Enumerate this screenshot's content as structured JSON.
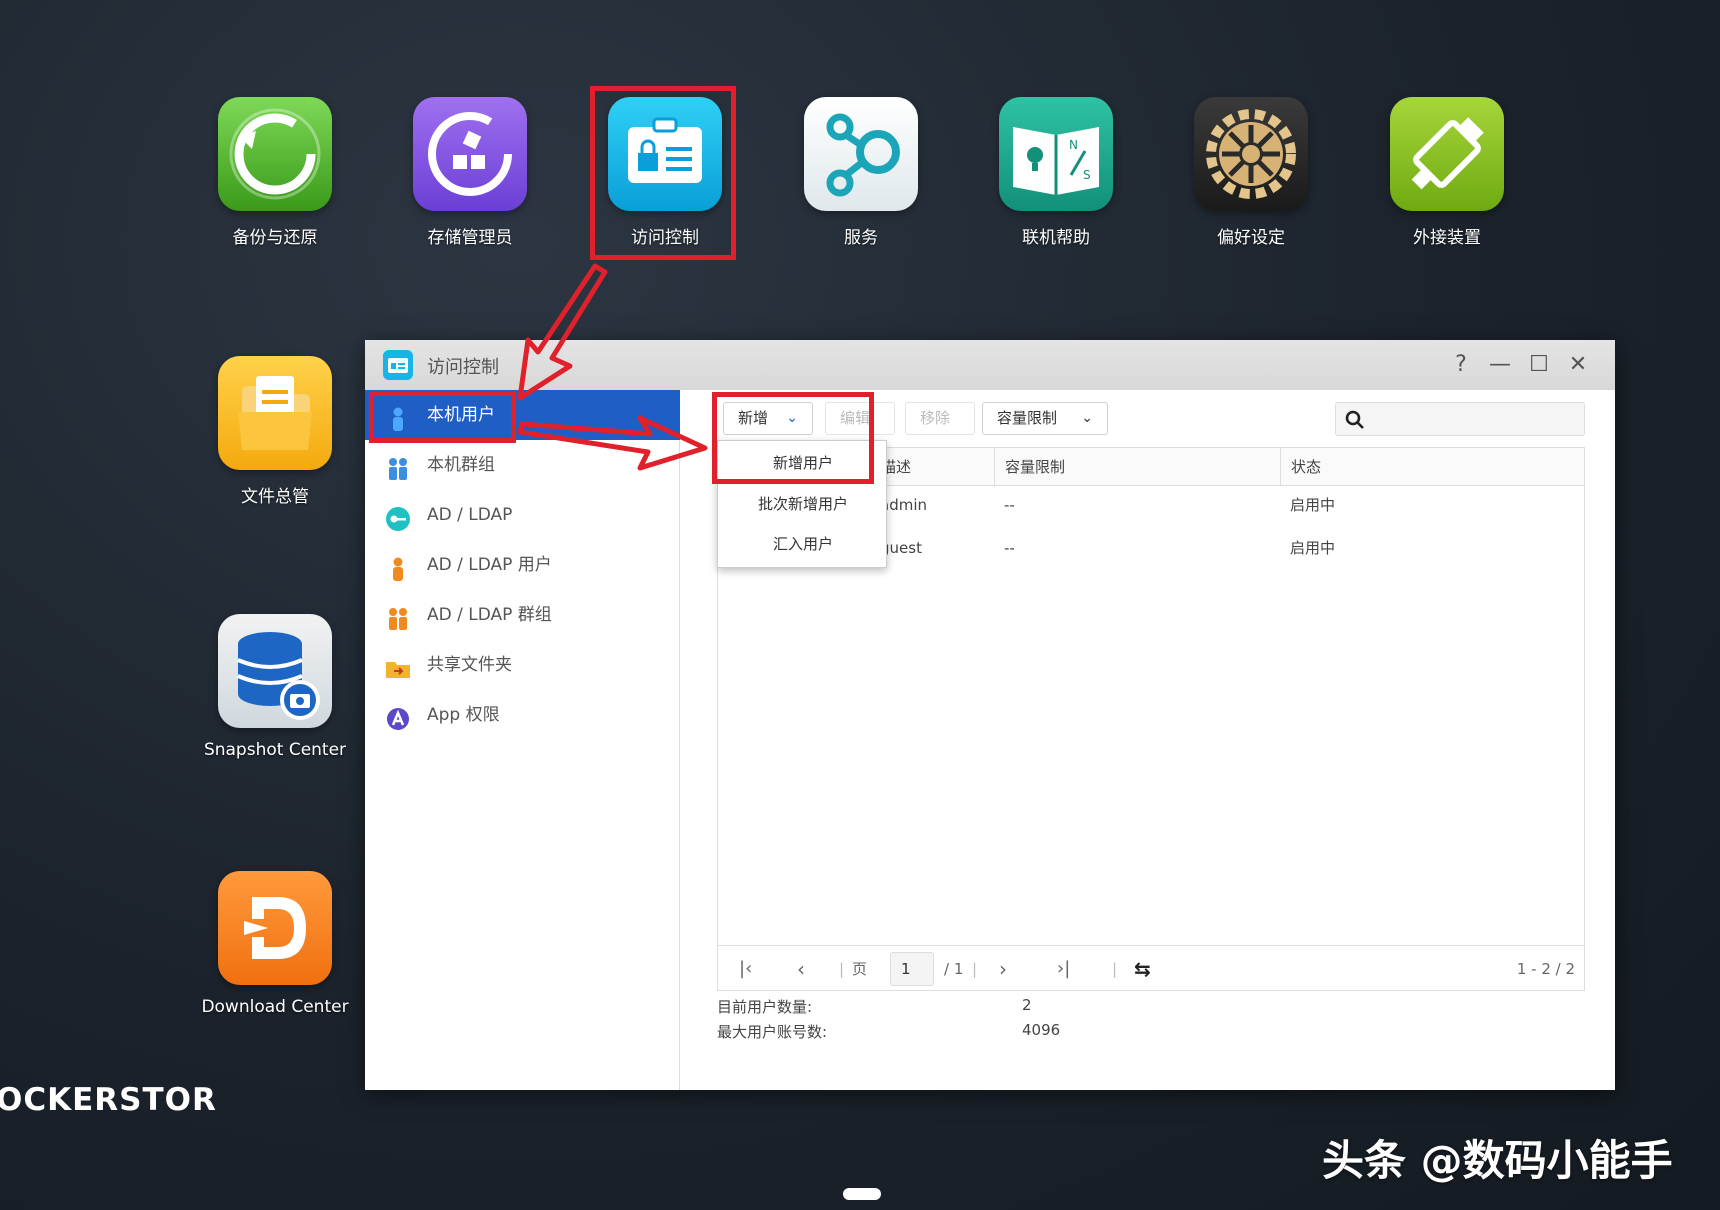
{
  "desktop": {
    "icons": [
      {
        "label": "备份与还原",
        "icon": "backup-restore-icon"
      },
      {
        "label": "存储管理员",
        "icon": "storage-manager-icon"
      },
      {
        "label": "访问控制",
        "icon": "access-control-icon"
      },
      {
        "label": "服务",
        "icon": "services-icon"
      },
      {
        "label": "联机帮助",
        "icon": "online-help-icon"
      },
      {
        "label": "偏好设定",
        "icon": "preferences-gear-icon"
      },
      {
        "label": "外接装置",
        "icon": "external-devices-icon"
      },
      {
        "label": "文件总管",
        "icon": "file-manager-icon"
      },
      {
        "label": "Snapshot Center",
        "icon": "snapshot-center-icon"
      },
      {
        "label": "Download Center",
        "icon": "download-center-icon"
      }
    ],
    "brand": "OCKERSTOR",
    "watermark": "头条 @数码小能手"
  },
  "window": {
    "title": "访问控制",
    "controls": [
      "?",
      "—",
      "☐",
      "✕"
    ],
    "sidebar": [
      {
        "label": "本机用户",
        "icon": "user-icon",
        "active": true
      },
      {
        "label": "本机群组",
        "icon": "group-icon"
      },
      {
        "label": "AD / LDAP",
        "icon": "ldap-key-icon"
      },
      {
        "label": "AD / LDAP 用户",
        "icon": "ldap-user-icon"
      },
      {
        "label": "AD / LDAP 群组",
        "icon": "ldap-group-icon"
      },
      {
        "label": "共享文件夹",
        "icon": "shared-folder-icon"
      },
      {
        "label": "App 权限",
        "icon": "app-permission-icon"
      }
    ],
    "toolbar": {
      "add": "新增",
      "edit": "编辑",
      "remove": "移除",
      "quota": "容量限制"
    },
    "dropdown": [
      "新增用户",
      "批次新增用户",
      "汇入用户"
    ],
    "table": {
      "headers": [
        "描述",
        "容量限制",
        "状态"
      ],
      "rows": [
        {
          "desc": "admin",
          "quota": "--",
          "status": "启用中"
        },
        {
          "desc": "guest",
          "quota": "--",
          "status": "启用中"
        }
      ]
    },
    "pager": {
      "page_label": "页",
      "page": "1",
      "total": "/ 1",
      "range": "1 - 2 / 2"
    },
    "stats": {
      "current_label": "目前用户数量:",
      "current_value": "2",
      "max_label": "最大用户账号数:",
      "max_value": "4096"
    }
  },
  "colors": {
    "accent": "#1f5ec4",
    "annotation": "#e0202a"
  }
}
